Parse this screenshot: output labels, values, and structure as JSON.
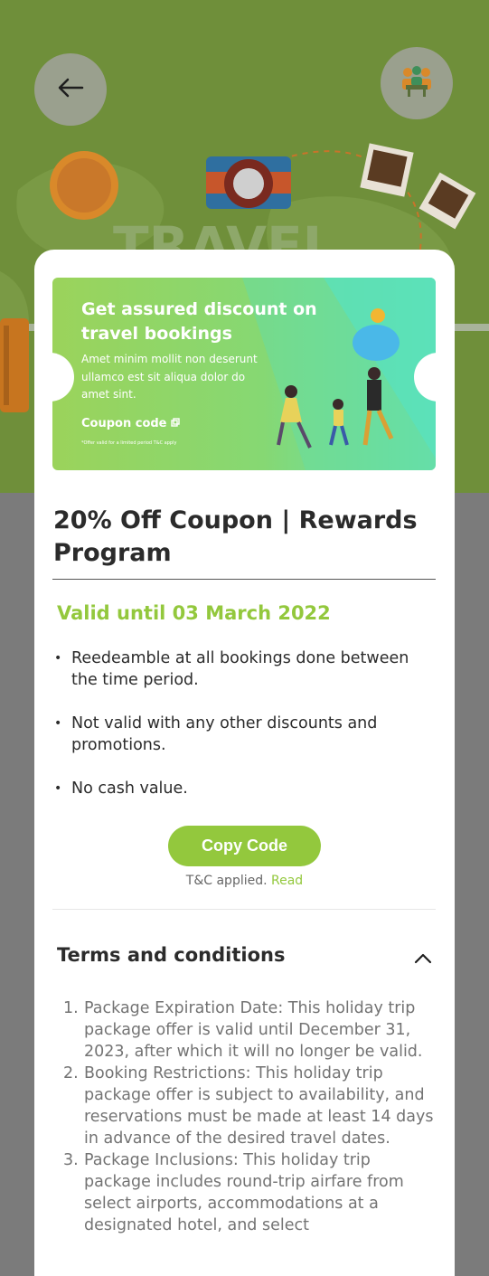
{
  "hero": {
    "watermark_text": "TRAVEL"
  },
  "banner": {
    "title": "Get assured  discount on travel bookings",
    "text": "Amet minim mollit non deserunt ullamco est sit aliqua dolor do amet sint.",
    "code_label": "Coupon code",
    "fine_print": "*Offer valid for a limited period T&C apply"
  },
  "coupon": {
    "title": "20% Off Coupon | Rewards Program",
    "valid_until": "Valid until 03 March 2022",
    "bullets": [
      "Reedeamble at all bookings done between the time period.",
      "Not valid with any other discounts and promotions.",
      "No cash value."
    ],
    "copy_button": "Copy Code",
    "tc_text": "T&C applied.",
    "tc_link": "Read"
  },
  "terms": {
    "heading": "Terms and conditions",
    "items": [
      {
        "num": "1.",
        "text": "Package Expiration Date: This holiday trip package offer is valid until December 31, 2023, after which it will no longer be valid."
      },
      {
        "num": "2.",
        "text": "Booking Restrictions: This holiday trip package offer is subject to availability, and reservations must be made at least 14 days in advance of the desired travel dates."
      },
      {
        "num": "3.",
        "text": "Package Inclusions: This holiday trip package includes round-trip airfare from select airports, accommodations at a designated hotel, and select"
      }
    ]
  },
  "colors": {
    "accent": "#93c83d",
    "hero_bg": "#6f8f3a",
    "overlay": "#7b7b7b"
  },
  "icons": {
    "back": "arrow-left-icon",
    "group": "group-meeting-icon",
    "copy": "copy-icon",
    "chevron": "chevron-up-icon"
  }
}
